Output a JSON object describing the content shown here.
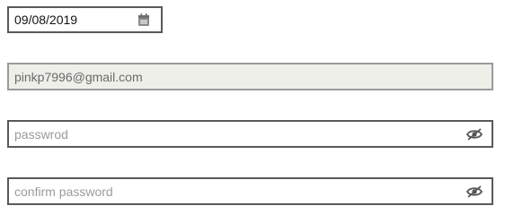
{
  "date_field": {
    "value": "09/08/2019",
    "icon": "calendar-icon"
  },
  "email_field": {
    "value": "pinkp7996@gmail.com",
    "state": "disabled"
  },
  "password_field": {
    "placeholder": "passwrod",
    "icon": "eye-slash-icon"
  },
  "confirm_password_field": {
    "placeholder": "confirm password",
    "icon": "eye-slash-icon"
  },
  "colors": {
    "border": "#595959",
    "disabled_background": "#efefe9",
    "placeholder": "#9b9b9b"
  }
}
